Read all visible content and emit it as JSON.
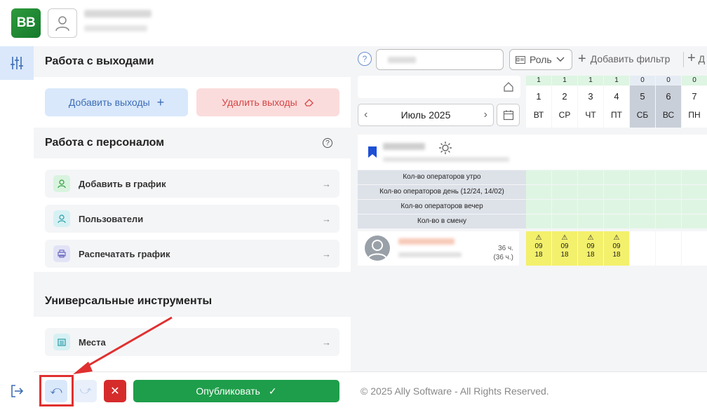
{
  "header": {
    "logo_text": "BB"
  },
  "left_panel": {
    "exits_section": {
      "title": "Работа с выходами",
      "add_label": "Добавить выходы",
      "delete_label": "Удалить выходы"
    },
    "staff_section": {
      "title": "Работа с персоналом",
      "help": "?",
      "items": [
        {
          "label": "Добавить в график",
          "icon": "add-user-icon",
          "color": "#d8f3de"
        },
        {
          "label": "Пользователи",
          "icon": "user-icon",
          "color": "#d6f1f3"
        },
        {
          "label": "Распечатать график",
          "icon": "printer-icon",
          "color": "#e3e3f7"
        }
      ]
    },
    "tools_section": {
      "title": "Универсальные инструменты",
      "items": [
        {
          "label": "Места",
          "icon": "building-icon",
          "color": "#d6f1f3"
        }
      ]
    }
  },
  "bottom_bar": {
    "publish_label": "Опубликовать",
    "copyright": "© 2025 Ally Software - All Rights Reserved."
  },
  "filters": {
    "help": "?",
    "role_label": "Роль",
    "add_filter_label": "Добавить фильтр",
    "extra_label": "Д"
  },
  "calendar": {
    "month_label": "Июль 2025",
    "days": [
      {
        "count": "1",
        "num": "1",
        "weekday": "ВТ",
        "weekend": false
      },
      {
        "count": "1",
        "num": "2",
        "weekday": "СР",
        "weekend": false
      },
      {
        "count": "1",
        "num": "3",
        "weekday": "ЧТ",
        "weekend": false
      },
      {
        "count": "1",
        "num": "4",
        "weekday": "ПТ",
        "weekend": false
      },
      {
        "count": "0",
        "num": "5",
        "weekday": "СБ",
        "weekend": true
      },
      {
        "count": "0",
        "num": "6",
        "weekday": "ВС",
        "weekend": true
      },
      {
        "count": "0",
        "num": "7",
        "weekday": "ПН",
        "weekend": false
      }
    ]
  },
  "stats": [
    "Кол-во операторов утро",
    "Кол-во операторов день (12/24, 14/02)",
    "Кол-во операторов вечер",
    "Кол-во в смену"
  ],
  "employee": {
    "hours": "36 ч.",
    "hours_paren": "(36 ч.)",
    "shifts": [
      {
        "warn": "⚠",
        "start": "09",
        "end": "18"
      },
      {
        "warn": "⚠",
        "start": "09",
        "end": "18"
      },
      {
        "warn": "⚠",
        "start": "09",
        "end": "18"
      },
      {
        "warn": "⚠",
        "start": "09",
        "end": "18"
      }
    ]
  }
}
